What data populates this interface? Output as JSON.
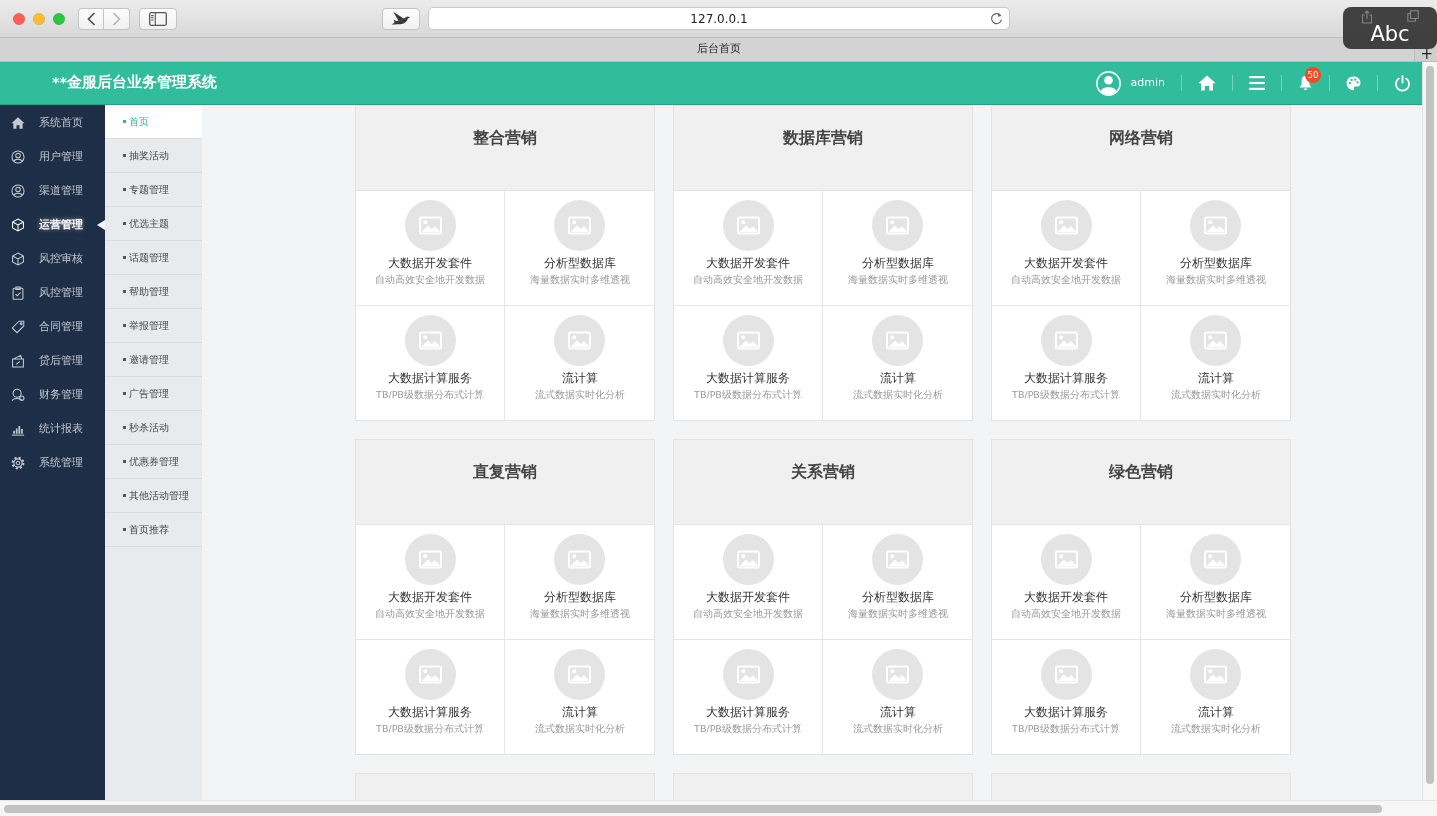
{
  "browser": {
    "back": {
      "disabled": false
    },
    "forward": {
      "disabled": true
    },
    "url": "127.0.0.1",
    "tab_title": "后台首页",
    "new_tab": "+",
    "input_source": "Abc"
  },
  "header": {
    "title": "**金服后台业务管理系统",
    "user": "admin",
    "notification_count": "50"
  },
  "sidebar": {
    "items": [
      {
        "label": "系统首页",
        "selected": false
      },
      {
        "label": "用户管理",
        "selected": false
      },
      {
        "label": "渠道管理",
        "selected": false
      },
      {
        "label": "运营管理",
        "selected": true
      },
      {
        "label": "风控审核",
        "selected": false
      },
      {
        "label": "风控管理",
        "selected": false
      },
      {
        "label": "合同管理",
        "selected": false
      },
      {
        "label": "贷后管理",
        "selected": false
      },
      {
        "label": "财务管理",
        "selected": false
      },
      {
        "label": "统计报表",
        "selected": false
      },
      {
        "label": "系统管理",
        "selected": false
      }
    ]
  },
  "submenu": {
    "items": [
      {
        "label": "首页",
        "selected": true
      },
      {
        "label": "抽奖活动",
        "selected": false
      },
      {
        "label": "专题管理",
        "selected": false
      },
      {
        "label": "优选主题",
        "selected": false
      },
      {
        "label": "话题管理",
        "selected": false
      },
      {
        "label": "帮助管理",
        "selected": false
      },
      {
        "label": "举报管理",
        "selected": false
      },
      {
        "label": "邀请管理",
        "selected": false
      },
      {
        "label": "广告管理",
        "selected": false
      },
      {
        "label": "秒杀活动",
        "selected": false
      },
      {
        "label": "优惠券管理",
        "selected": false
      },
      {
        "label": "其他活动管理",
        "selected": false
      },
      {
        "label": "首页推荐",
        "selected": false
      }
    ]
  },
  "sections": [
    {
      "kind": "full",
      "title": "整合营销",
      "products": [
        {
          "name": "大数据开发套件",
          "description": "自动高效安全地开发数据"
        },
        {
          "name": "分析型数据库",
          "description": "海量数据实时多维透视"
        },
        {
          "name": "大数据计算服务",
          "description": "TB/PB级数据分布式计算"
        },
        {
          "name": "流计算",
          "description": "流式数据实时化分析"
        }
      ]
    },
    {
      "kind": "full",
      "title": "数据库营销",
      "products": [
        {
          "name": "大数据开发套件",
          "description": "自动高效安全地开发数据"
        },
        {
          "name": "分析型数据库",
          "description": "海量数据实时多维透视"
        },
        {
          "name": "大数据计算服务",
          "description": "TB/PB级数据分布式计算"
        },
        {
          "name": "流计算",
          "description": "流式数据实时化分析"
        }
      ]
    },
    {
      "kind": "full",
      "title": "网络营销",
      "products": [
        {
          "name": "大数据开发套件",
          "description": "自动高效安全地开发数据"
        },
        {
          "name": "分析型数据库",
          "description": "海量数据实时多维透视"
        },
        {
          "name": "大数据计算服务",
          "description": "TB/PB级数据分布式计算"
        },
        {
          "name": "流计算",
          "description": "流式数据实时化分析"
        }
      ]
    },
    {
      "kind": "full",
      "title": "直复营销",
      "products": [
        {
          "name": "大数据开发套件",
          "description": "自动高效安全地开发数据"
        },
        {
          "name": "分析型数据库",
          "description": "海量数据实时多维透视"
        },
        {
          "name": "大数据计算服务",
          "description": "TB/PB级数据分布式计算"
        },
        {
          "name": "流计算",
          "description": "流式数据实时化分析"
        }
      ]
    },
    {
      "kind": "full",
      "title": "关系营销",
      "products": [
        {
          "name": "大数据开发套件",
          "description": "自动高效安全地开发数据"
        },
        {
          "name": "分析型数据库",
          "description": "海量数据实时多维透视"
        },
        {
          "name": "大数据计算服务",
          "description": "TB/PB级数据分布式计算"
        },
        {
          "name": "流计算",
          "description": "流式数据实时化分析"
        }
      ]
    },
    {
      "kind": "full",
      "title": "绿色营销",
      "products": [
        {
          "name": "大数据开发套件",
          "description": "自动高效安全地开发数据"
        },
        {
          "name": "分析型数据库",
          "description": "海量数据实时多维透视"
        },
        {
          "name": "大数据计算服务",
          "description": "TB/PB级数据分布式计算"
        },
        {
          "name": "流计算",
          "description": "流式数据实时化分析"
        }
      ]
    },
    {
      "kind": "cut"
    },
    {
      "kind": "cut"
    },
    {
      "kind": "cut"
    }
  ]
}
